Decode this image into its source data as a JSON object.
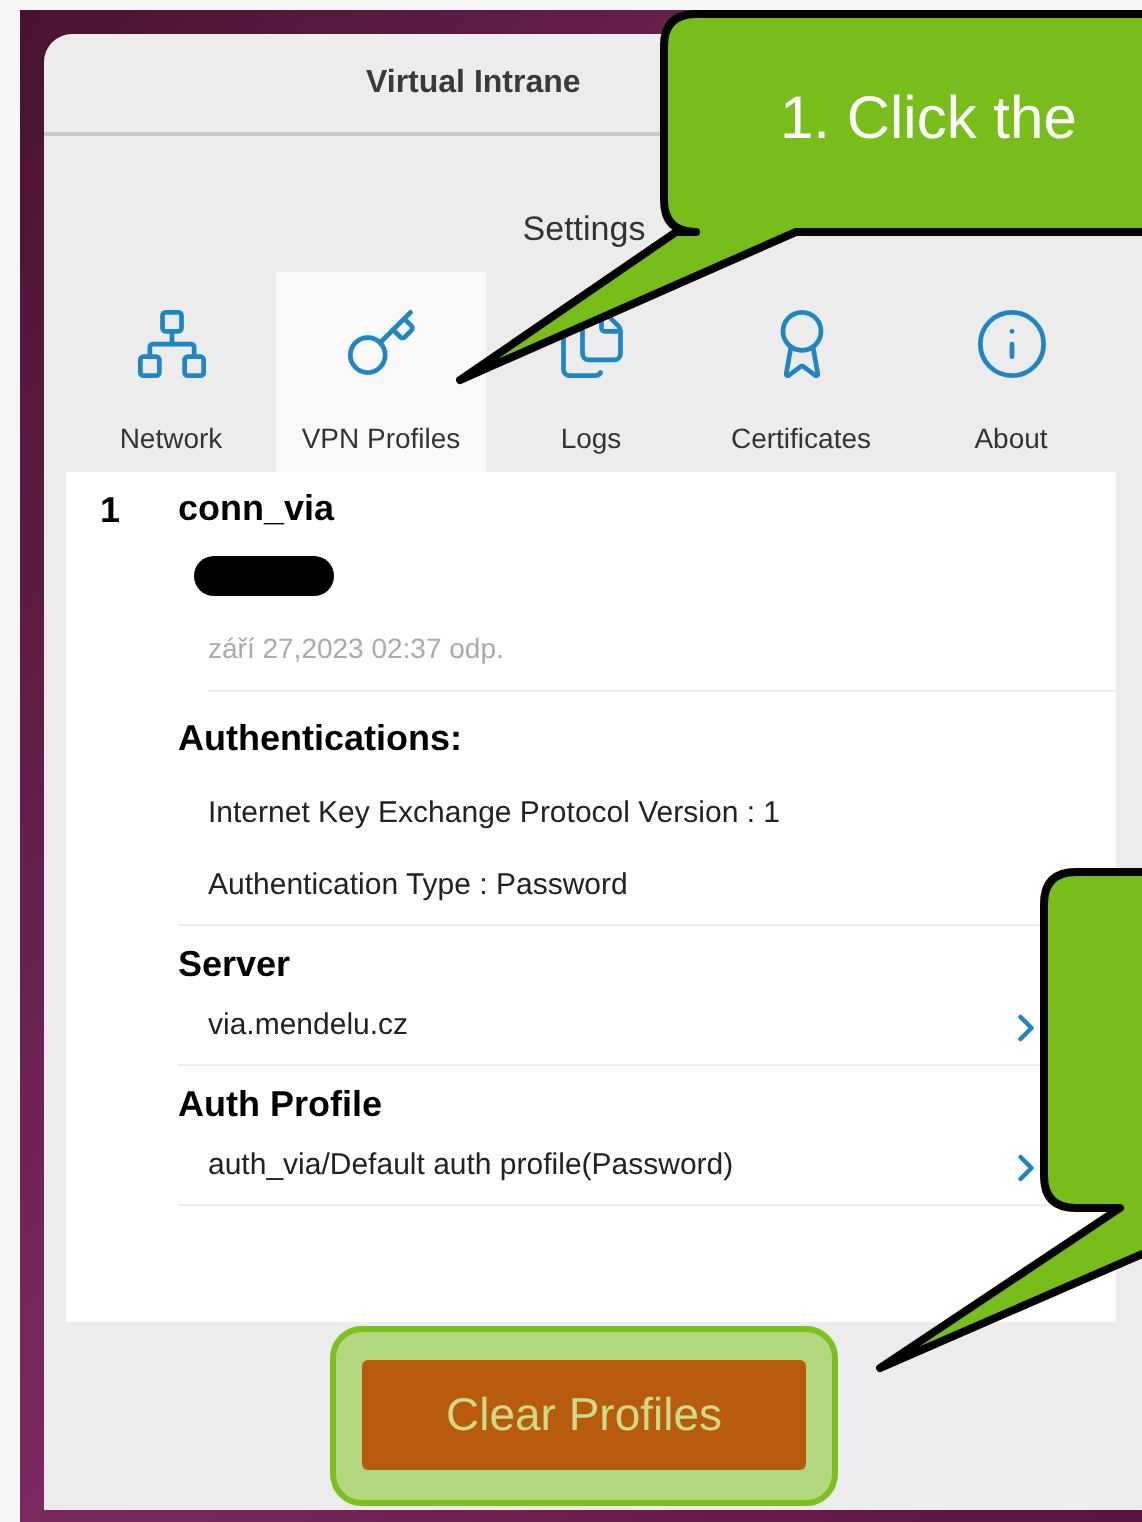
{
  "window": {
    "title": "Virtual Intrane"
  },
  "heading": "Settings",
  "tabs": [
    {
      "label": "Network",
      "kind": "network",
      "selected": false
    },
    {
      "label": "VPN Profiles",
      "kind": "key",
      "selected": true
    },
    {
      "label": "Logs",
      "kind": "logs",
      "selected": false
    },
    {
      "label": "Certificates",
      "kind": "certificate",
      "selected": false
    },
    {
      "label": "About",
      "kind": "about",
      "selected": false
    }
  ],
  "profile": {
    "index": "1",
    "name": "conn_via",
    "redacted": true,
    "date": "září 27,2023 02:37 odp.",
    "sections": [
      {
        "title": "Authentications:",
        "items": [
          {
            "text": "Internet Key Exchange Protocol Version : 1",
            "chevron": false
          },
          {
            "text": "Authentication Type : Password",
            "chevron": false
          }
        ]
      },
      {
        "title": "Server",
        "items": [
          {
            "text": "via.mendelu.cz",
            "chevron": true
          }
        ]
      },
      {
        "title": "Auth Profile",
        "items": [
          {
            "text": "auth_via/Default auth profile(Password)",
            "chevron": true
          }
        ]
      }
    ]
  },
  "button": {
    "label": "Clear Profiles",
    "highlighted": true
  },
  "annotations": [
    {
      "kind": "top",
      "text": "1. Click the"
    },
    {
      "kind": "right"
    }
  ]
}
